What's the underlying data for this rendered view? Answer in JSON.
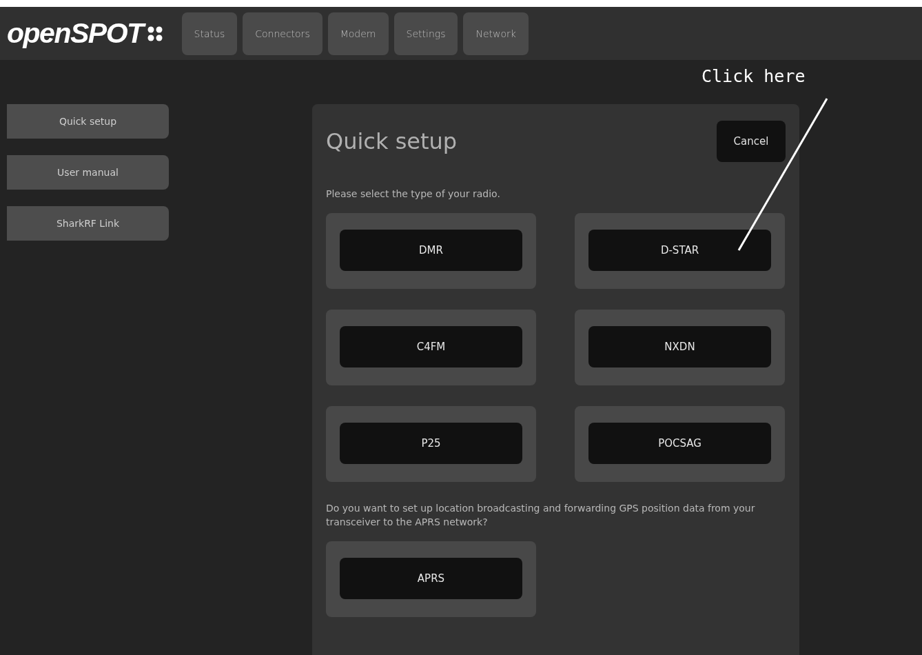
{
  "header": {
    "logo": "openSPOT",
    "tabs": [
      "Status",
      "Connectors",
      "Modem",
      "Settings",
      "Network"
    ]
  },
  "sidebar": {
    "items": [
      "Quick setup",
      "User manual",
      "SharkRF Link"
    ]
  },
  "panel": {
    "title": "Quick setup",
    "cancel": "Cancel",
    "prompt": "Please select the type of your radio.",
    "radio_types": [
      "DMR",
      "D-STAR",
      "C4FM",
      "NXDN",
      "P25",
      "POCSAG"
    ],
    "aprs_prompt": "Do you want to set up location broadcasting and forwarding GPS position data from your transceiver to the APRS network?",
    "aprs_options": [
      "APRS"
    ]
  },
  "annotation": {
    "text": "Click here"
  }
}
